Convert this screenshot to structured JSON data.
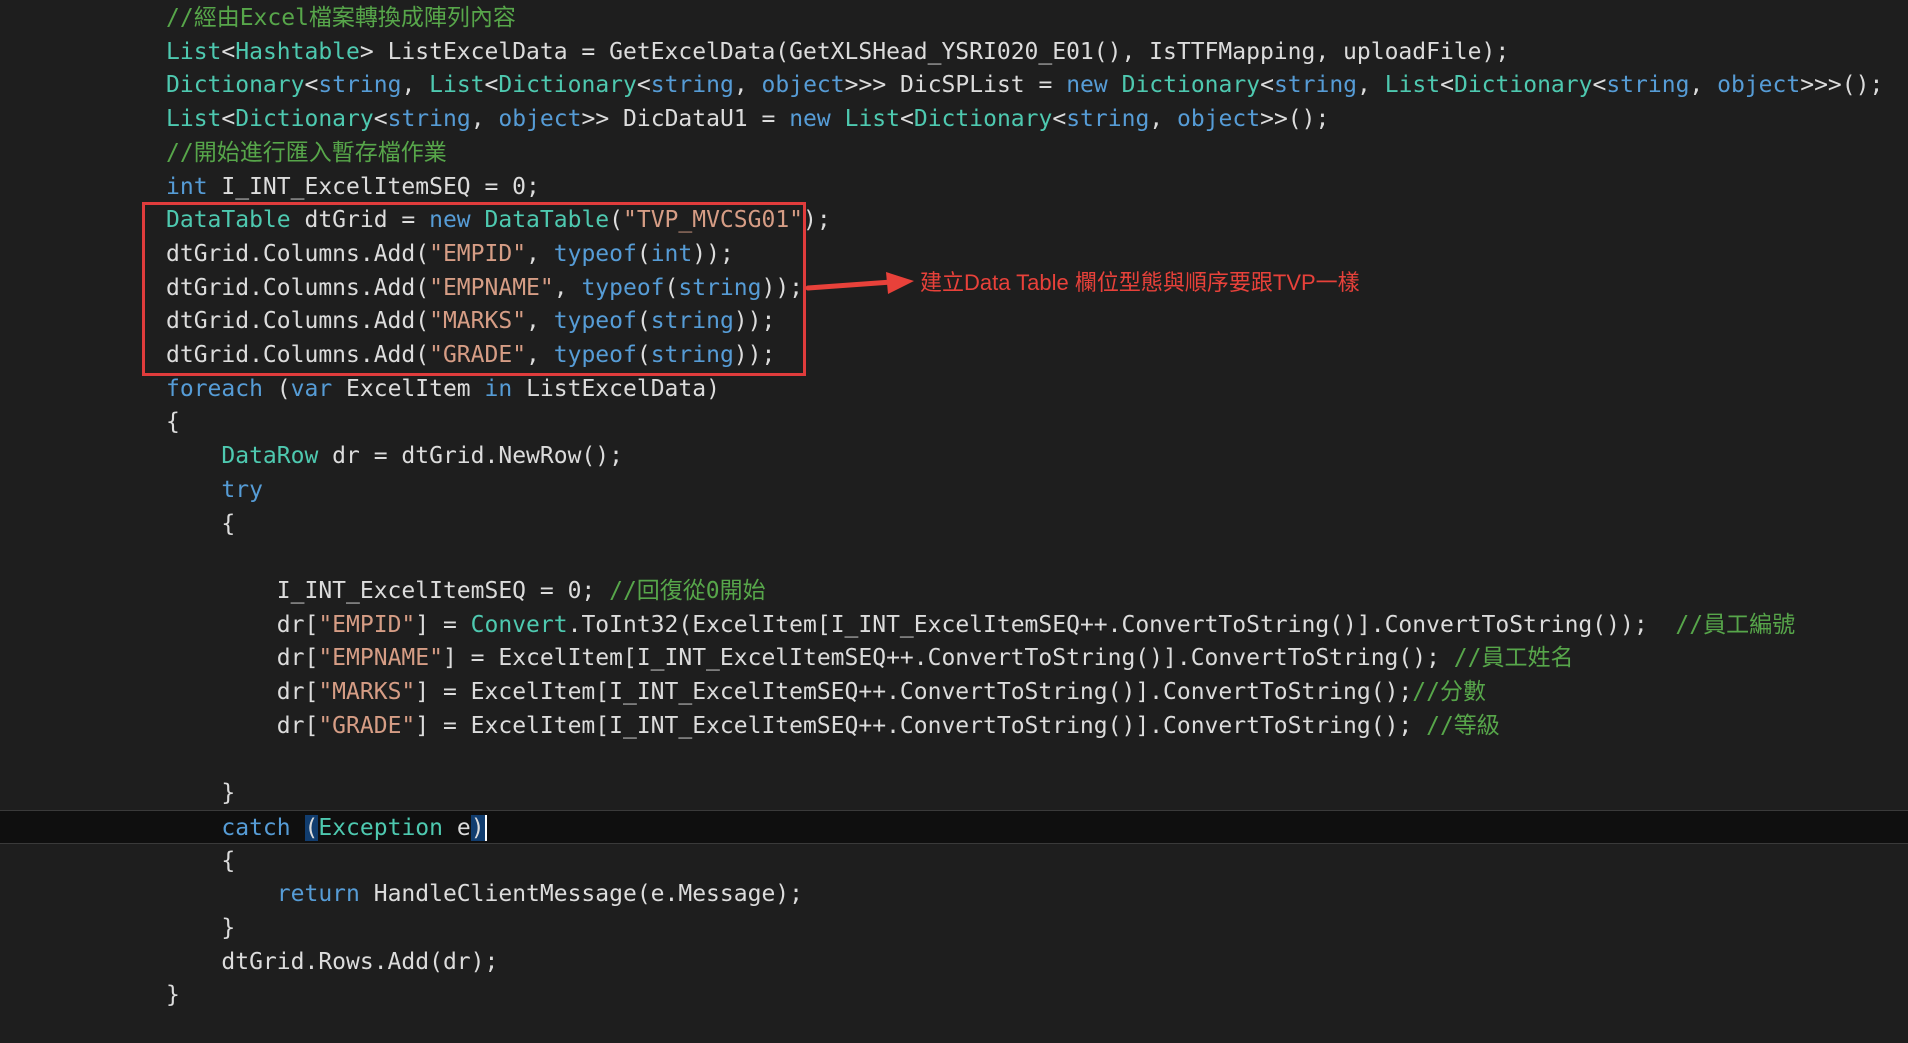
{
  "editor": {
    "lines": [
      {
        "tokens": [
          {
            "t": "//經由Excel檔案轉換成陣列內容",
            "c": "comment"
          }
        ]
      },
      {
        "tokens": [
          {
            "t": "List",
            "c": "type"
          },
          {
            "t": "<",
            "c": "plain"
          },
          {
            "t": "Hashtable",
            "c": "type"
          },
          {
            "t": "> ListExcelData = GetExcelData(GetXLSHead_YSRI020_E01(), IsTTFMapping, uploadFile);",
            "c": "plain"
          }
        ]
      },
      {
        "tokens": [
          {
            "t": "Dictionary",
            "c": "type"
          },
          {
            "t": "<",
            "c": "plain"
          },
          {
            "t": "string",
            "c": "keyword"
          },
          {
            "t": ", ",
            "c": "plain"
          },
          {
            "t": "List",
            "c": "type"
          },
          {
            "t": "<",
            "c": "plain"
          },
          {
            "t": "Dictionary",
            "c": "type"
          },
          {
            "t": "<",
            "c": "plain"
          },
          {
            "t": "string",
            "c": "keyword"
          },
          {
            "t": ", ",
            "c": "plain"
          },
          {
            "t": "object",
            "c": "keyword"
          },
          {
            "t": ">>> DicSPList = ",
            "c": "plain"
          },
          {
            "t": "new",
            "c": "keyword"
          },
          {
            "t": " ",
            "c": "plain"
          },
          {
            "t": "Dictionary",
            "c": "type"
          },
          {
            "t": "<",
            "c": "plain"
          },
          {
            "t": "string",
            "c": "keyword"
          },
          {
            "t": ", ",
            "c": "plain"
          },
          {
            "t": "List",
            "c": "type"
          },
          {
            "t": "<",
            "c": "plain"
          },
          {
            "t": "Dictionary",
            "c": "type"
          },
          {
            "t": "<",
            "c": "plain"
          },
          {
            "t": "string",
            "c": "keyword"
          },
          {
            "t": ", ",
            "c": "plain"
          },
          {
            "t": "object",
            "c": "keyword"
          },
          {
            "t": ">>>();",
            "c": "plain"
          }
        ]
      },
      {
        "tokens": [
          {
            "t": "List",
            "c": "type"
          },
          {
            "t": "<",
            "c": "plain"
          },
          {
            "t": "Dictionary",
            "c": "type"
          },
          {
            "t": "<",
            "c": "plain"
          },
          {
            "t": "string",
            "c": "keyword"
          },
          {
            "t": ", ",
            "c": "plain"
          },
          {
            "t": "object",
            "c": "keyword"
          },
          {
            "t": ">> DicDataU1 = ",
            "c": "plain"
          },
          {
            "t": "new",
            "c": "keyword"
          },
          {
            "t": " ",
            "c": "plain"
          },
          {
            "t": "List",
            "c": "type"
          },
          {
            "t": "<",
            "c": "plain"
          },
          {
            "t": "Dictionary",
            "c": "type"
          },
          {
            "t": "<",
            "c": "plain"
          },
          {
            "t": "string",
            "c": "keyword"
          },
          {
            "t": ", ",
            "c": "plain"
          },
          {
            "t": "object",
            "c": "keyword"
          },
          {
            "t": ">>();",
            "c": "plain"
          }
        ]
      },
      {
        "tokens": [
          {
            "t": "//開始進行匯入暫存檔作業",
            "c": "comment"
          }
        ]
      },
      {
        "tokens": [
          {
            "t": "int",
            "c": "keyword"
          },
          {
            "t": " I_INT_ExcelItemSEQ = 0;",
            "c": "plain"
          }
        ]
      },
      {
        "tokens": [
          {
            "t": "DataTable",
            "c": "type"
          },
          {
            "t": " dtGrid = ",
            "c": "plain"
          },
          {
            "t": "new",
            "c": "keyword"
          },
          {
            "t": " ",
            "c": "plain"
          },
          {
            "t": "DataTable",
            "c": "type"
          },
          {
            "t": "(",
            "c": "plain"
          },
          {
            "t": "\"TVP_MVCSG01\"",
            "c": "string"
          },
          {
            "t": ");",
            "c": "plain"
          }
        ]
      },
      {
        "tokens": [
          {
            "t": "dtGrid.Columns.Add(",
            "c": "plain"
          },
          {
            "t": "\"EMPID\"",
            "c": "string"
          },
          {
            "t": ", ",
            "c": "plain"
          },
          {
            "t": "typeof",
            "c": "keyword"
          },
          {
            "t": "(",
            "c": "plain"
          },
          {
            "t": "int",
            "c": "keyword"
          },
          {
            "t": "));",
            "c": "plain"
          }
        ]
      },
      {
        "tokens": [
          {
            "t": "dtGrid.Columns.Add(",
            "c": "plain"
          },
          {
            "t": "\"EMPNAME\"",
            "c": "string"
          },
          {
            "t": ", ",
            "c": "plain"
          },
          {
            "t": "typeof",
            "c": "keyword"
          },
          {
            "t": "(",
            "c": "plain"
          },
          {
            "t": "string",
            "c": "keyword"
          },
          {
            "t": "));",
            "c": "plain"
          }
        ]
      },
      {
        "tokens": [
          {
            "t": "dtGrid.Columns.Add(",
            "c": "plain"
          },
          {
            "t": "\"MARKS\"",
            "c": "string"
          },
          {
            "t": ", ",
            "c": "plain"
          },
          {
            "t": "typeof",
            "c": "keyword"
          },
          {
            "t": "(",
            "c": "plain"
          },
          {
            "t": "string",
            "c": "keyword"
          },
          {
            "t": "));",
            "c": "plain"
          }
        ]
      },
      {
        "tokens": [
          {
            "t": "dtGrid.Columns.Add(",
            "c": "plain"
          },
          {
            "t": "\"GRADE\"",
            "c": "string"
          },
          {
            "t": ", ",
            "c": "plain"
          },
          {
            "t": "typeof",
            "c": "keyword"
          },
          {
            "t": "(",
            "c": "plain"
          },
          {
            "t": "string",
            "c": "keyword"
          },
          {
            "t": "));",
            "c": "plain"
          }
        ]
      },
      {
        "tokens": [
          {
            "t": "foreach",
            "c": "keyword"
          },
          {
            "t": " (",
            "c": "plain"
          },
          {
            "t": "var",
            "c": "keyword"
          },
          {
            "t": " ExcelItem ",
            "c": "plain"
          },
          {
            "t": "in",
            "c": "keyword"
          },
          {
            "t": " ListExcelData)",
            "c": "plain"
          }
        ]
      },
      {
        "tokens": [
          {
            "t": "{",
            "c": "plain"
          }
        ]
      },
      {
        "tokens": [
          {
            "t": "    ",
            "c": "plain"
          },
          {
            "t": "DataRow",
            "c": "type"
          },
          {
            "t": " dr = dtGrid.NewRow();",
            "c": "plain"
          }
        ]
      },
      {
        "tokens": [
          {
            "t": "    ",
            "c": "plain"
          },
          {
            "t": "try",
            "c": "keyword"
          }
        ]
      },
      {
        "tokens": [
          {
            "t": "    {",
            "c": "plain"
          }
        ]
      },
      {
        "tokens": []
      },
      {
        "tokens": [
          {
            "t": "        I_INT_ExcelItemSEQ = 0; ",
            "c": "plain"
          },
          {
            "t": "//回復從0開始",
            "c": "comment"
          }
        ]
      },
      {
        "tokens": [
          {
            "t": "        dr[",
            "c": "plain"
          },
          {
            "t": "\"EMPID\"",
            "c": "string"
          },
          {
            "t": "] = ",
            "c": "plain"
          },
          {
            "t": "Convert",
            "c": "type"
          },
          {
            "t": ".ToInt32(ExcelItem[I_INT_ExcelItemSEQ++.ConvertToString()].ConvertToString());  ",
            "c": "plain"
          },
          {
            "t": "//員工編號",
            "c": "comment"
          }
        ]
      },
      {
        "tokens": [
          {
            "t": "        dr[",
            "c": "plain"
          },
          {
            "t": "\"EMPNAME\"",
            "c": "string"
          },
          {
            "t": "] = ExcelItem[I_INT_ExcelItemSEQ++.ConvertToString()].ConvertToString(); ",
            "c": "plain"
          },
          {
            "t": "//員工姓名",
            "c": "comment"
          }
        ]
      },
      {
        "tokens": [
          {
            "t": "        dr[",
            "c": "plain"
          },
          {
            "t": "\"MARKS\"",
            "c": "string"
          },
          {
            "t": "] = ExcelItem[I_INT_ExcelItemSEQ++.ConvertToString()].ConvertToString();",
            "c": "plain"
          },
          {
            "t": "//分數",
            "c": "comment"
          }
        ]
      },
      {
        "tokens": [
          {
            "t": "        dr[",
            "c": "plain"
          },
          {
            "t": "\"GRADE\"",
            "c": "string"
          },
          {
            "t": "] = ExcelItem[I_INT_ExcelItemSEQ++.ConvertToString()].ConvertToString(); ",
            "c": "plain"
          },
          {
            "t": "//等級",
            "c": "comment"
          }
        ]
      },
      {
        "tokens": []
      },
      {
        "tokens": [
          {
            "t": "    }",
            "c": "plain"
          }
        ]
      },
      {
        "tokens": [
          {
            "t": "    ",
            "c": "plain"
          },
          {
            "t": "catch",
            "c": "keyword"
          },
          {
            "t": " ",
            "c": "plain"
          },
          {
            "t": "(",
            "c": "brace"
          },
          {
            "t": "Exception",
            "c": "type"
          },
          {
            "t": " e",
            "c": "plain"
          },
          {
            "t": ")",
            "c": "brace"
          },
          {
            "t": "",
            "c": "caret"
          }
        ],
        "current": true
      },
      {
        "tokens": [
          {
            "t": "    {",
            "c": "plain"
          }
        ]
      },
      {
        "tokens": [
          {
            "t": "        ",
            "c": "plain"
          },
          {
            "t": "return",
            "c": "keyword"
          },
          {
            "t": " HandleClientMessage(e.Message);",
            "c": "plain"
          }
        ]
      },
      {
        "tokens": [
          {
            "t": "    }",
            "c": "plain"
          }
        ]
      },
      {
        "tokens": [
          {
            "t": "    dtGrid.Rows.Add(dr);",
            "c": "plain"
          }
        ]
      },
      {
        "tokens": [
          {
            "t": "}",
            "c": "plain"
          }
        ]
      }
    ]
  },
  "annotation": {
    "text": "建立Data Table 欄位型態與順序要跟TVP一樣",
    "color": "#e8413a"
  },
  "colors": {
    "background": "#1e1e1e",
    "comment": "#57a64a",
    "keyword": "#569cd6",
    "type": "#4ec9b0",
    "string": "#d69d85",
    "plain": "#dcdcdc",
    "highlight_box": "#e03c3c"
  }
}
